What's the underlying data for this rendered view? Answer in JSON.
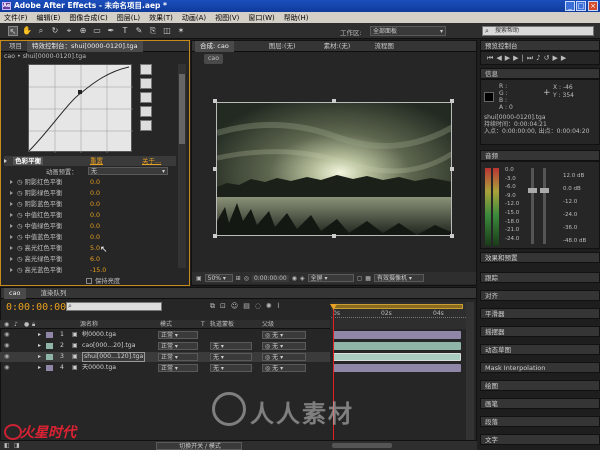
{
  "window": {
    "title": "Adobe After Effects - 未命名项目.aep *",
    "icon_label": "Ae"
  },
  "menu": [
    "文件(F)",
    "编辑(E)",
    "图像合成(C)",
    "图层(L)",
    "效果(T)",
    "动画(A)",
    "视图(V)",
    "窗口(W)",
    "帮助(H)"
  ],
  "toolbar": {
    "workspace_label": "工作区:",
    "workspace_value": "全部面板",
    "search_placeholder": "搜索帮助"
  },
  "left_panel": {
    "tab_project": "项目",
    "tab_effects": "特效控制台：shui[0000-0120].tga",
    "breadcrumb": "cao • shui[0000-0120].tga",
    "effect_name": "色彩平衡",
    "reset_label": "重置",
    "about_label": "关于...",
    "preset_label": "动画预置：",
    "preset_value": "无",
    "properties": [
      {
        "name": "阴影红色平衡",
        "value": "0.0"
      },
      {
        "name": "阴影绿色平衡",
        "value": "0.0"
      },
      {
        "name": "阴影蓝色平衡",
        "value": "0.0"
      },
      {
        "name": "中值红色平衡",
        "value": "0.0"
      },
      {
        "name": "中值绿色平衡",
        "value": "0.0"
      },
      {
        "name": "中值蓝色平衡",
        "value": "0.0"
      },
      {
        "name": "高光红色平衡",
        "value": "5.0"
      },
      {
        "name": "高光绿色平衡",
        "value": "6.0"
      },
      {
        "name": "高光蓝色平衡",
        "value": "-15.0"
      }
    ],
    "preserve_label": "保持亮度"
  },
  "comp_panel": {
    "tab_comp": "合成: cao",
    "tab_layer": "图层:(无)",
    "tab_footage": "素材:(无)",
    "tab_flow": "流程图",
    "comp_name": "cao",
    "zoom": "50%",
    "timecode": "0:00:00:00",
    "resolution": "全屏",
    "camera": "有效摄像机"
  },
  "right_panel": {
    "preview_tab": "预览控制台",
    "info_tab": "信息",
    "info": {
      "r": "R :",
      "g": "G :",
      "b": "B :",
      "a": "A : 0",
      "x": "X : -46",
      "y": "Y : 354",
      "filename": "shui[0000-0120].tga",
      "duration": "持续时间：0:00:04:21",
      "in_out": "入点：0:00:00:00, 出点：0:00:04:20"
    },
    "audio_tab": "音频",
    "audio_levels": [
      "0.0",
      "-3.0",
      "-6.0",
      "-9.0",
      "-12.0",
      "-15.0",
      "-18.0",
      "-21.0",
      "-24.0"
    ],
    "audio_db": [
      "12.0 dB",
      "0.0 dB",
      "-12.0",
      "-24.0",
      "-36.0",
      "-48.0 dB"
    ],
    "sections": [
      "效果和预置",
      "跟踪",
      "对齐",
      "平滑器",
      "摇摆器",
      "动态草图",
      "Mask Interpolation",
      "绘图",
      "画笔",
      "段落",
      "文字"
    ]
  },
  "timeline": {
    "tab_comp": "cao",
    "tab_render": "渲染队列",
    "timecode": "0:00:00:00",
    "col_name": "源名称",
    "col_mode": "模式",
    "col_t": "T",
    "col_trkmat": "轨道蒙板",
    "col_parent": "父级",
    "ruler": [
      "0s",
      "02s",
      "04s"
    ],
    "mode_value": "正常",
    "trkmat_value": "无",
    "parent_value": "无",
    "layers": [
      {
        "num": "1",
        "name": "树0000.tga",
        "color": "#8f86a8"
      },
      {
        "num": "2",
        "name": "cao[000...20].tga",
        "color": "#8fb5a8"
      },
      {
        "num": "3",
        "name": "shui[000...120].tga",
        "color": "#8fb5a8"
      },
      {
        "num": "4",
        "name": "天0000.tga",
        "color": "#8f86a8"
      }
    ],
    "switch_label": "切换开关 / 模式"
  },
  "watermark": {
    "text": "人人素材",
    "logo": "火星时代"
  }
}
